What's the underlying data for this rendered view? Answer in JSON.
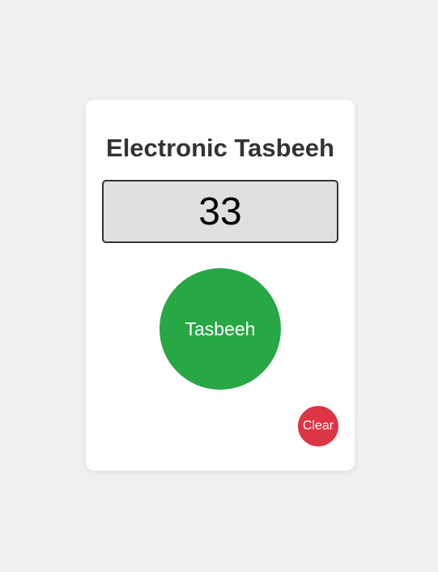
{
  "app": {
    "title": "Electronic Tasbeeh"
  },
  "counter": {
    "value": "33"
  },
  "buttons": {
    "tasbeeh_label": "Tasbeeh",
    "clear_label": "Clear"
  },
  "colors": {
    "background": "#f0f0f0",
    "card": "#ffffff",
    "display_bg": "#e0e0e0",
    "tasbeeh": "#28a745",
    "clear": "#dc3545",
    "text": "#333333"
  }
}
